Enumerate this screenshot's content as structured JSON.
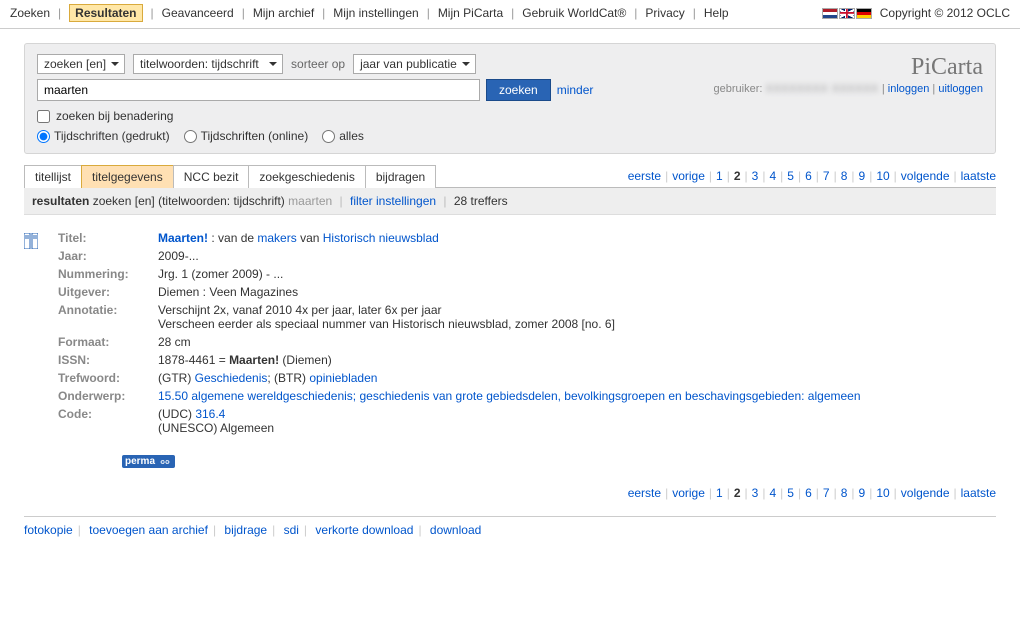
{
  "top_nav": {
    "items": [
      "Zoeken",
      "Resultaten",
      "Geavanceerd",
      "Mijn archief",
      "Mijn instellingen",
      "Mijn PiCarta",
      "Gebruik WorldCat®",
      "Privacy",
      "Help"
    ],
    "active_index": 1
  },
  "copyright": "Copyright © 2012 OCLC",
  "search": {
    "mode_select": "zoeken [en]",
    "field_select": "titelwoorden: tijdschrift",
    "sort_label": "sorteer op",
    "sort_select": "jaar van publicatie",
    "query": "maarten",
    "button": "zoeken",
    "less": "minder",
    "approx_label": "zoeken bij benadering",
    "radios": {
      "printed": "Tijdschriften (gedrukt)",
      "online": "Tijdschriften (online)",
      "all": "alles"
    }
  },
  "brand": "PiCarta",
  "userline": {
    "label": "gebruiker:",
    "name_masked": "XXXXXXXX XXXXXX",
    "login": "inloggen",
    "logout": "uitloggen"
  },
  "tabs": {
    "items": [
      "titellijst",
      "titelgegevens",
      "NCC bezit",
      "zoekgeschiedenis",
      "bijdragen"
    ],
    "active_index": 1
  },
  "pager": {
    "first": "eerste",
    "prev": "vorige",
    "pages": [
      "1",
      "2",
      "3",
      "4",
      "5",
      "6",
      "7",
      "8",
      "9",
      "10"
    ],
    "current": "2",
    "next": "volgende",
    "last": "laatste"
  },
  "resultbar": {
    "label": "resultaten",
    "mode": "zoeken [en]",
    "field": "(titelwoorden: tijdschrift)",
    "query": "maarten",
    "filter_link": "filter instellingen",
    "hits": "28 treffers"
  },
  "record": {
    "labels": {
      "title": "Titel:",
      "year": "Jaar:",
      "numbering": "Nummering:",
      "publisher": "Uitgever:",
      "annotation": "Annotatie:",
      "format": "Formaat:",
      "issn": "ISSN:",
      "keyword": "Trefwoord:",
      "subject": "Onderwerp:",
      "code": "Code:"
    },
    "title_main": "Maarten!",
    "title_rest1": " : van de ",
    "title_link1": "makers",
    "title_rest2": " van ",
    "title_link2": "Historisch nieuwsblad",
    "year": "2009-...",
    "numbering": "Jrg. 1 (zomer 2009) - ...",
    "publisher": "Diemen : Veen Magazines",
    "annotation_l1": "Verschijnt 2x, vanaf 2010 4x per jaar, later 6x per jaar",
    "annotation_l2": "Verscheen eerder als speciaal nummer van Historisch nieuwsblad, zomer 2008 [no. 6]",
    "format": "28 cm",
    "issn_num": "1878-4461 = ",
    "issn_bold": "Maarten!",
    "issn_rest": " (Diemen)",
    "keyword_pre1": "(GTR) ",
    "keyword_link1": "Geschiedenis",
    "keyword_mid": "; (BTR) ",
    "keyword_link2": "opiniebladen",
    "subject_link": "15.50 algemene wereldgeschiedenis; geschiedenis van grote gebiedsdelen, bevolkingsgroepen en beschavingsgebieden: algemeen",
    "code_pre": "(UDC) ",
    "code_link": "316.4",
    "code_l2": "(UNESCO) Algemeen"
  },
  "permalink": "perma",
  "bottom": {
    "items": [
      "fotokopie",
      "toevoegen aan archief",
      "bijdrage",
      "sdi",
      "verkorte download",
      "download"
    ]
  }
}
